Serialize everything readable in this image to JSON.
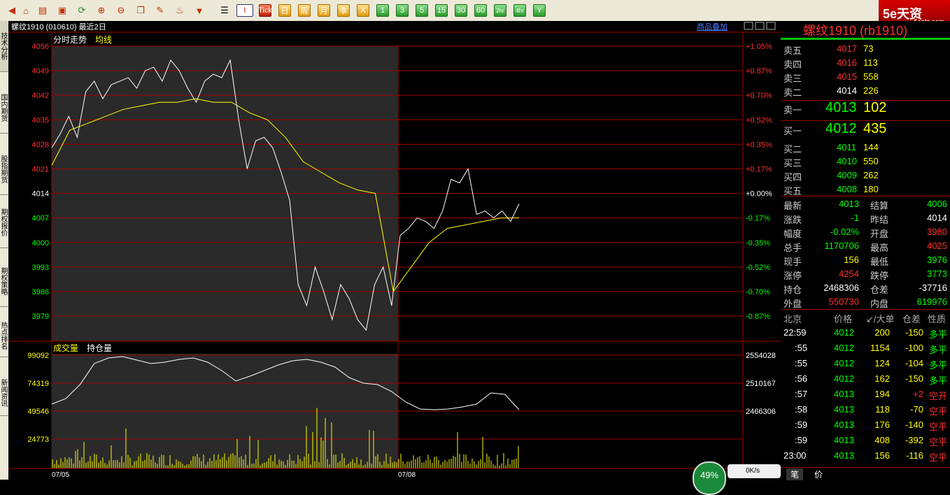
{
  "toolbar": {
    "periods": [
      "Tick",
      "日",
      "周",
      "月",
      "季",
      "X",
      "1",
      "3",
      "5",
      "15",
      "30",
      "60",
      "2hr",
      "4hr",
      "Y"
    ]
  },
  "logo": {
    "text": "5e天资",
    "url": "5eplz.com"
  },
  "left_tabs": [
    "技术分析",
    "国内期货",
    "股指期货",
    "期权报价",
    "期权策略",
    "热点排名",
    "新闻资讯"
  ],
  "chart": {
    "header": "螺纹1910 (010610)  最近2日",
    "overlay_link": "商品叠加",
    "upper_labels": {
      "fenshi": "分时走势",
      "junxian": "均线"
    },
    "lower_labels": {
      "volume": "成交量",
      "oi": "持仓量"
    },
    "dates": [
      "07/05",
      "07/08"
    ],
    "price_ticks": [
      "4056",
      "4049",
      "4042",
      "4035",
      "4028",
      "4021",
      "4014",
      "4007",
      "4000",
      "3993",
      "3986",
      "3979"
    ],
    "pct_ticks": [
      "+1.05%",
      "+0.87%",
      "+0.70%",
      "+0.52%",
      "+0.35%",
      "+0.17%",
      "+0.00%",
      "-0.17%",
      "-0.35%",
      "-0.52%",
      "-0.70%",
      "-0.87%"
    ],
    "vol_ticks": [
      "99092",
      "74319",
      "49546",
      "24773"
    ],
    "oi_ticks": [
      "2554028",
      "2510167",
      "2466306"
    ],
    "colors": {
      "price": "#ffffff",
      "avg": "#ffff00",
      "grid": "#a00000",
      "shade": "#2a2a2a",
      "volume": "#ffff00"
    }
  },
  "chart_data": {
    "type": "line",
    "title": "螺纹1910 (010610) 最近2日",
    "ylim": [
      3972,
      4058
    ],
    "reference_price": 4014,
    "series": [
      {
        "name": "分时走势",
        "points": [
          4027,
          4031,
          4036,
          4030,
          4043,
          4046,
          4041,
          4045,
          4046,
          4047,
          4044,
          4049,
          4050,
          4046,
          4052,
          4049,
          4044,
          4040,
          4046,
          4048,
          4047,
          4052,
          4035,
          4021,
          4029,
          4030,
          4027,
          4020,
          4012,
          3988,
          3982,
          3993,
          3986,
          3978,
          3988,
          3984,
          3978,
          3975,
          3988,
          3993,
          3982,
          4002,
          4004,
          4007,
          4006,
          4004,
          4009,
          4018,
          4017,
          4021,
          4008,
          4009,
          4007,
          4009,
          4006,
          4011
        ]
      },
      {
        "name": "均线",
        "points": [
          4022,
          4032,
          4034,
          4036,
          4038,
          4039,
          4040,
          4040,
          4041,
          4040,
          4040,
          4037,
          4035,
          4030,
          4023,
          4020,
          4017,
          4015,
          4014,
          3986,
          3993,
          4000,
          4004,
          4005,
          4006,
          4007,
          4007
        ]
      }
    ]
  },
  "panel": {
    "title": "螺纹1910 (rb1910)",
    "asks": [
      {
        "label": "卖五",
        "price": "4017",
        "vol": "73"
      },
      {
        "label": "卖四",
        "price": "4016",
        "vol": "113"
      },
      {
        "label": "卖三",
        "price": "4015",
        "vol": "558"
      },
      {
        "label": "卖二",
        "price": "4014",
        "vol": "226"
      }
    ],
    "ask1": {
      "label": "卖一",
      "price": "4013",
      "vol": "102"
    },
    "bid1": {
      "label": "买一",
      "price": "4012",
      "vol": "435"
    },
    "bids": [
      {
        "label": "买二",
        "price": "4011",
        "vol": "144"
      },
      {
        "label": "买三",
        "price": "4010",
        "vol": "550"
      },
      {
        "label": "买四",
        "price": "4009",
        "vol": "262"
      },
      {
        "label": "买五",
        "price": "4008",
        "vol": "180"
      }
    ],
    "stats": [
      {
        "l1": "最新",
        "v1": "4013",
        "l2": "结算",
        "v2": "4006"
      },
      {
        "l1": "涨跌",
        "v1": "-1",
        "l2": "昨结",
        "v2": "4014"
      },
      {
        "l1": "幅度",
        "v1": "-0.02%",
        "l2": "开盘",
        "v2": "3980"
      },
      {
        "l1": "总手",
        "v1": "1170706",
        "l2": "最高",
        "v2": "4025"
      },
      {
        "l1": "现手",
        "v1": "156",
        "l2": "最低",
        "v2": "3976"
      },
      {
        "l1": "涨停",
        "v1": "4254",
        "l2": "跌停",
        "v2": "3773"
      },
      {
        "l1": "持仓",
        "v1": "2468306",
        "l2": "仓差",
        "v2": "-37716"
      },
      {
        "l1": "外盘",
        "v1": "550730",
        "l2": "内盘",
        "v2": "619976"
      }
    ],
    "ticks_header": {
      "loc": "北京",
      "price": "价格",
      "big": "↙/大单",
      "chg": "仓差",
      "nature": "性质"
    },
    "ticks": [
      {
        "t": "22:59",
        "p": "4012",
        "v": "200",
        "d": "-150",
        "n": "多平"
      },
      {
        "t": ":55",
        "p": "4012",
        "v": "1154",
        "d": "-100",
        "n": "多平"
      },
      {
        "t": ":55",
        "p": "4012",
        "v": "124",
        "d": "-104",
        "n": "多平"
      },
      {
        "t": ":56",
        "p": "4012",
        "v": "162",
        "d": "-150",
        "n": "多平"
      },
      {
        "t": ":57",
        "p": "4013",
        "v": "194",
        "d": "+2",
        "n": "空开"
      },
      {
        "t": ":58",
        "p": "4013",
        "v": "118",
        "d": "-70",
        "n": "空平"
      },
      {
        "t": ":59",
        "p": "4013",
        "v": "176",
        "d": "-140",
        "n": "空平"
      },
      {
        "t": ":59",
        "p": "4013",
        "v": "408",
        "d": "-392",
        "n": "空平"
      },
      {
        "t": "23:00",
        "p": "4013",
        "v": "156",
        "d": "-116",
        "n": "空平"
      }
    ],
    "bottom_tabs": [
      "笔",
      "价"
    ]
  },
  "status": {
    "percent": "49%",
    "speed": "0K/s"
  }
}
